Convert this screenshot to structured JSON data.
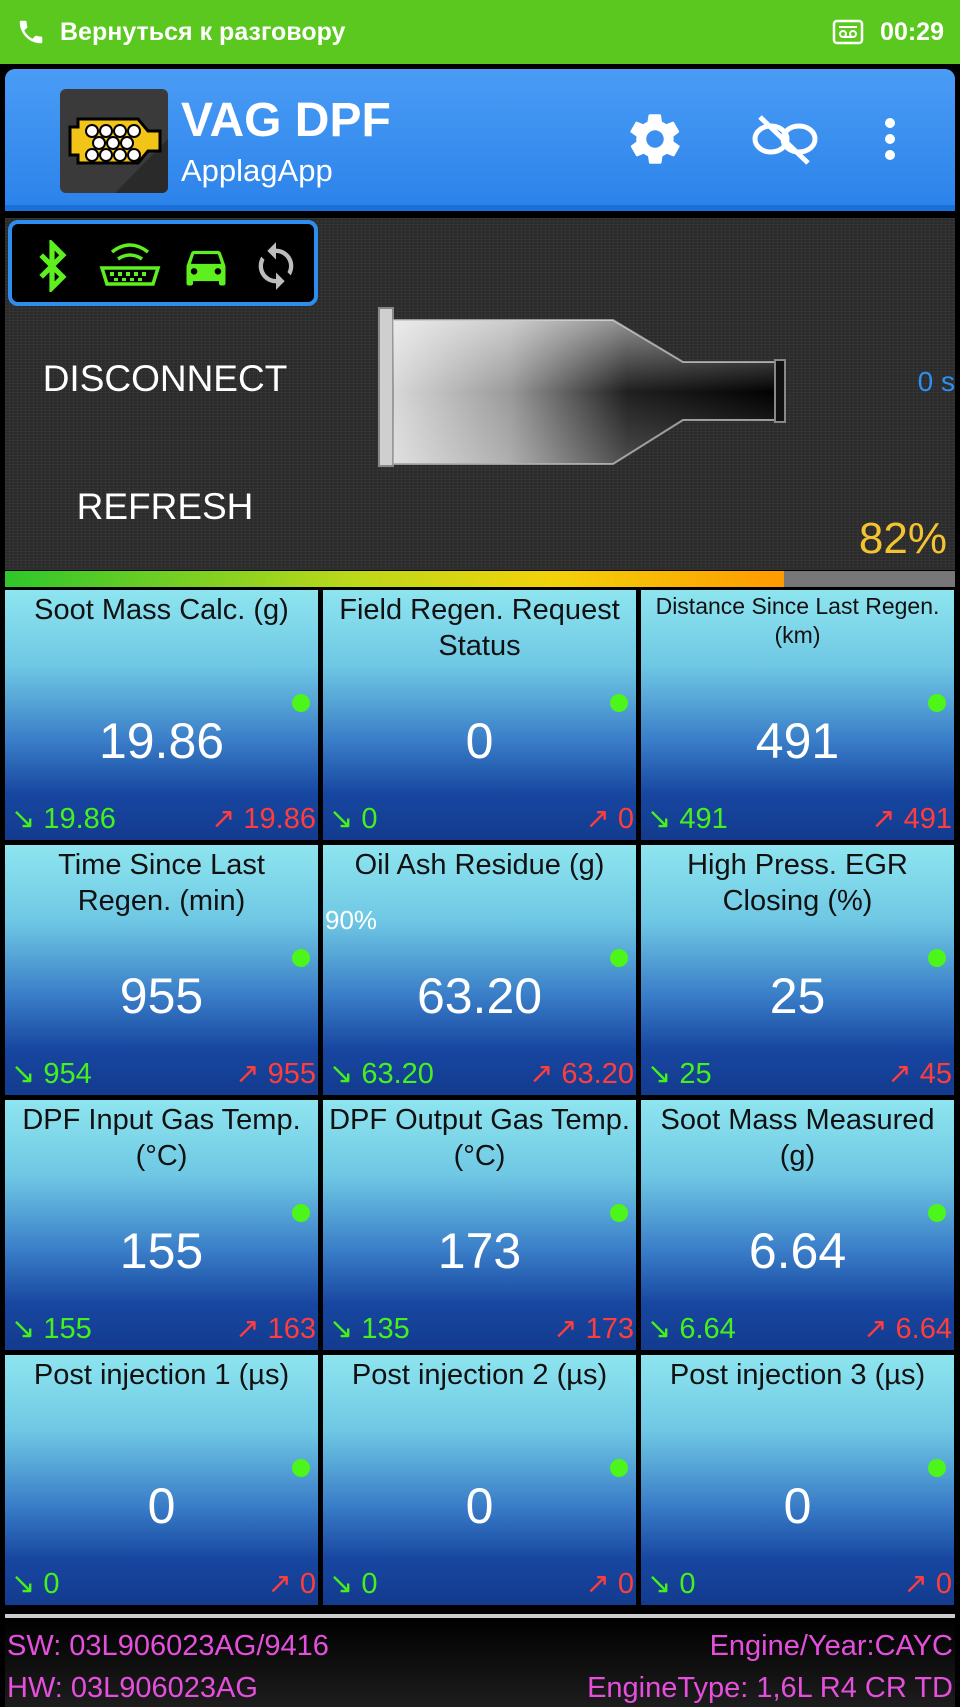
{
  "status_bar": {
    "call_text": "Вернуться к разговору",
    "time": "00:29"
  },
  "app_bar": {
    "title": "VAG DPF",
    "subtitle": "ApplagApp",
    "icons": [
      "settings-icon",
      "no-link-icon",
      "overflow-menu-icon"
    ]
  },
  "connection_icons": [
    "bluetooth-icon",
    "obd-adapter-icon",
    "car-icon",
    "sync-icon"
  ],
  "hero": {
    "disconnect_label": "DISCONNECT",
    "refresh_label": "REFRESH",
    "timer": "0 s",
    "dpf_load_percent": "82%"
  },
  "load_bar": {
    "fraction": 0.82
  },
  "tiles": [
    {
      "label": "Soot Mass Calc. (g)",
      "value": "19.86",
      "min": "19.86",
      "max": "19.86"
    },
    {
      "label": "Field Regen. Request Status",
      "value": "0",
      "min": "0",
      "max": "0"
    },
    {
      "label": "Distance Since Last Regen. (km)",
      "value": "491",
      "min": "491",
      "max": "491"
    },
    {
      "label": "Time Since Last Regen. (min)",
      "value": "955",
      "min": "954",
      "max": "955"
    },
    {
      "label": "Oil Ash Residue (g)",
      "value": "63.20",
      "min": "63.20",
      "max": "63.20",
      "extra": "90%"
    },
    {
      "label": "High Press. EGR Closing (%)",
      "value": "25",
      "min": "25",
      "max": "45"
    },
    {
      "label": "DPF Input Gas Temp. (°C)",
      "value": "155",
      "min": "155",
      "max": "163"
    },
    {
      "label": "DPF Output Gas Temp. (°C)",
      "value": "173",
      "min": "135",
      "max": "173"
    },
    {
      "label": "Soot Mass Measured (g)",
      "value": "6.64",
      "min": "6.64",
      "max": "6.64"
    },
    {
      "label": "Post injection 1 (µs)",
      "value": "0",
      "min": "0",
      "max": "0"
    },
    {
      "label": "Post injection 2 (µs)",
      "value": "0",
      "min": "0",
      "max": "0"
    },
    {
      "label": "Post injection 3 (µs)",
      "value": "0",
      "min": "0",
      "max": "0"
    }
  ],
  "footer": {
    "sw": "SW: 03L906023AG/9416",
    "hw": "HW: 03L906023AG",
    "engine_year": "Engine/Year:CAYC",
    "engine_type": "EngineType: 1,6L R4 CR TD"
  },
  "colors": {
    "status_bar": "#5ac81f",
    "app_bar": "#2c83ea",
    "min_value": "#45f01c",
    "max_value": "#ff3d3d",
    "footer_text": "#e44fdc",
    "percent_text": "#f4c430"
  }
}
